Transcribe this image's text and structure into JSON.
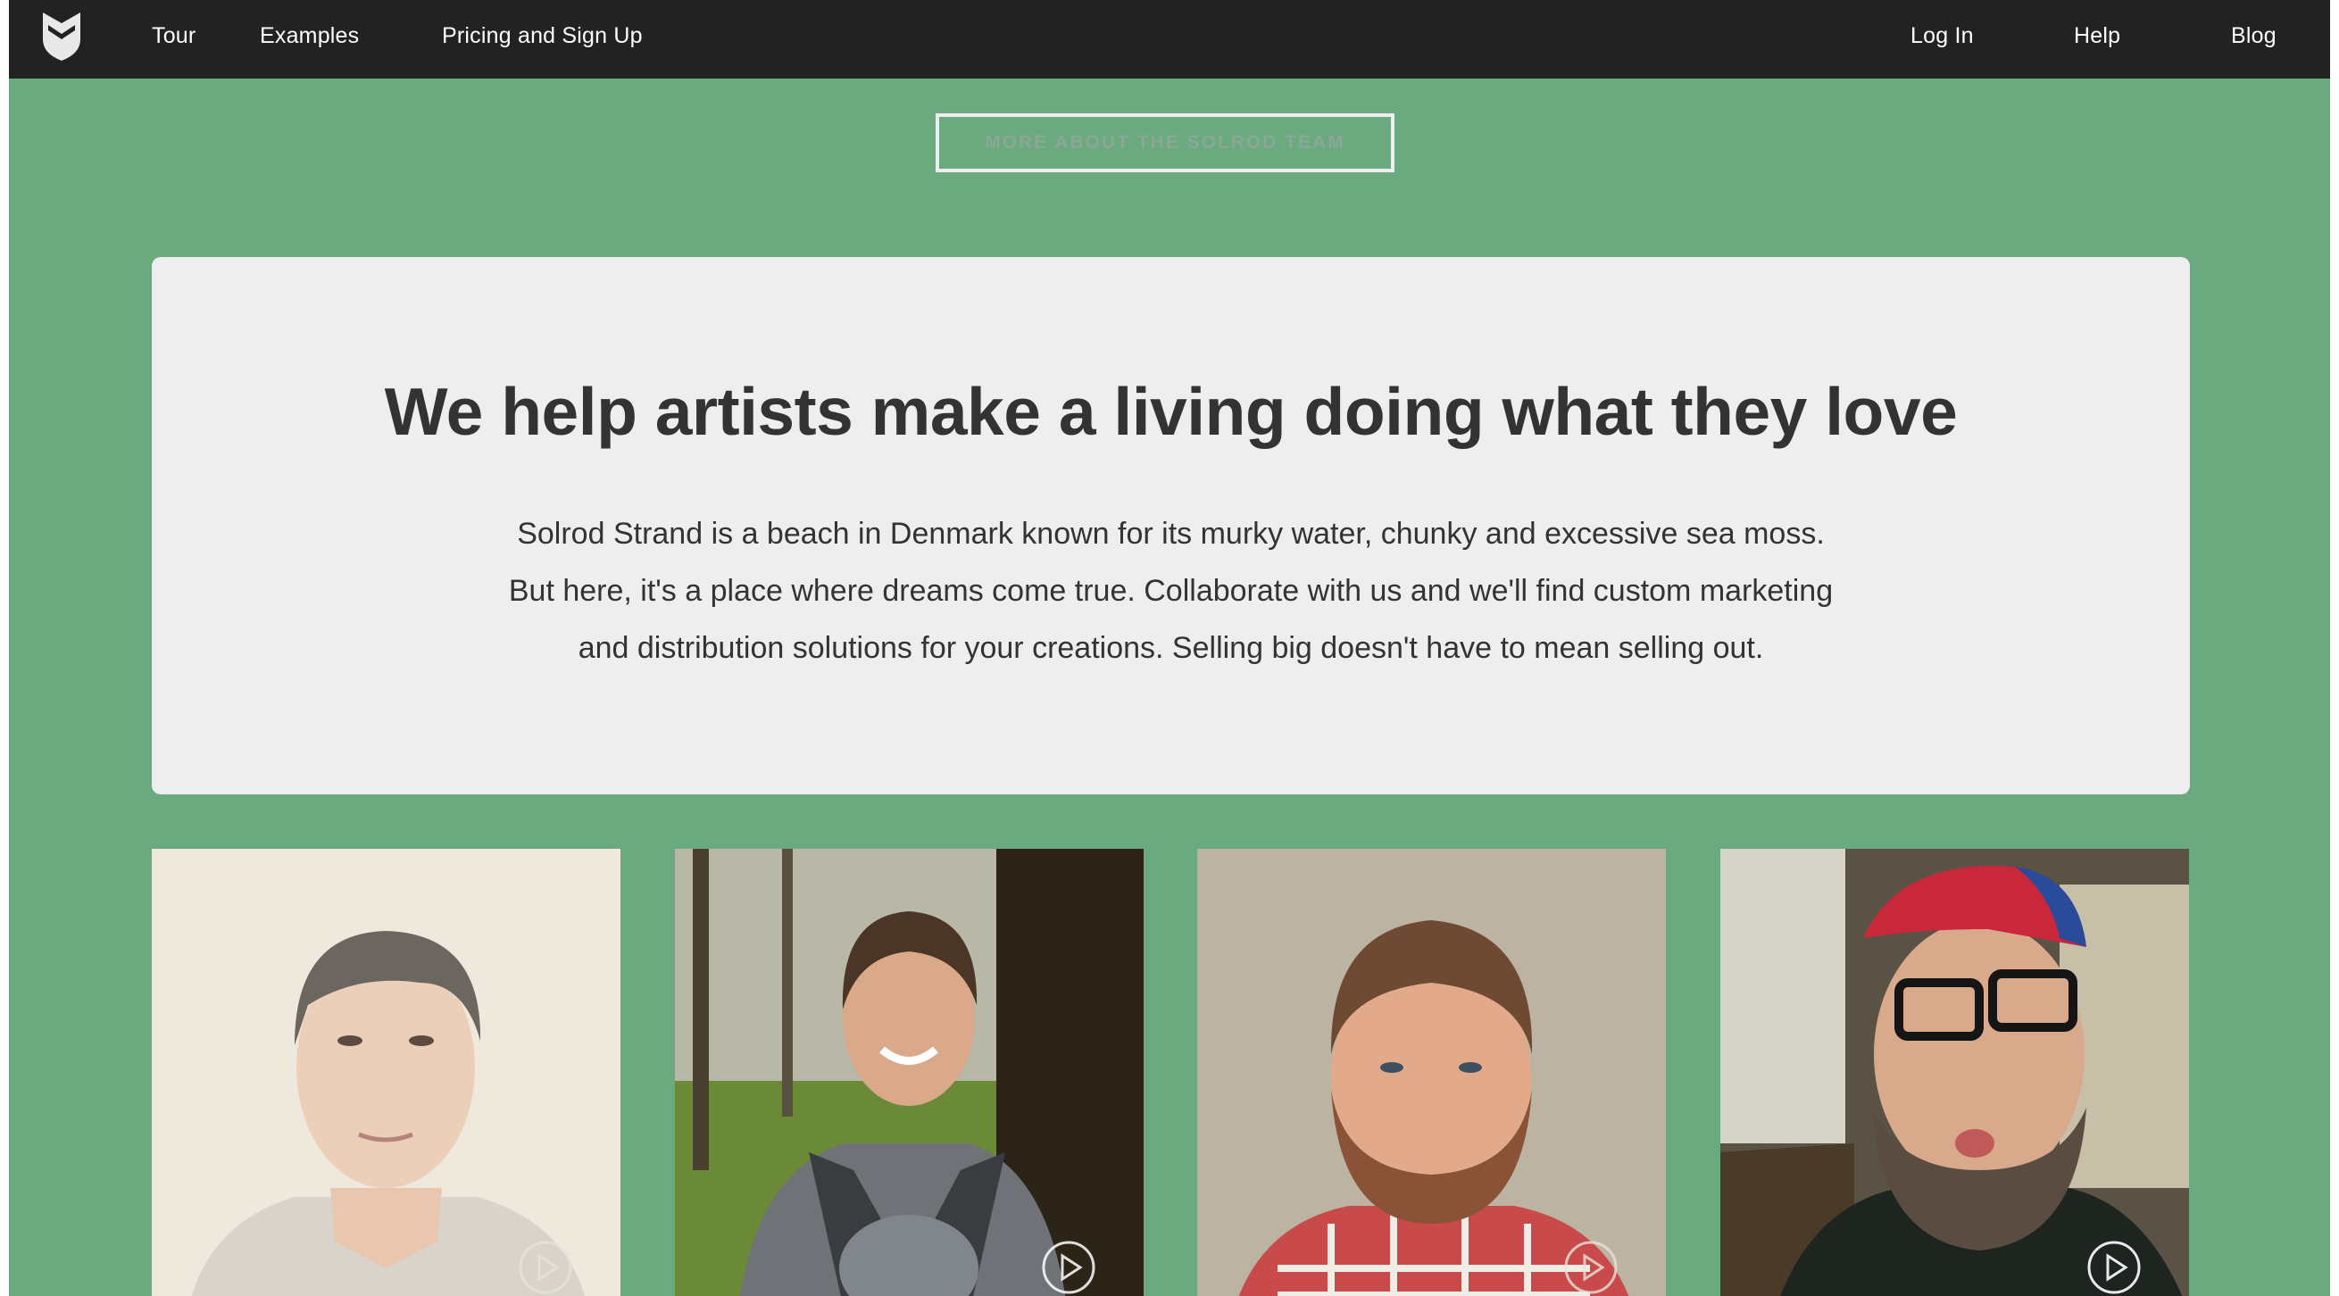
{
  "nav": {
    "logo_icon": "shield-leaf-logo-icon",
    "left_links": [
      "Tour",
      "Examples",
      "Pricing and Sign Up"
    ],
    "right_links": [
      "Log In",
      "Help",
      "Blog"
    ]
  },
  "more_button": {
    "label": "MORE ABOUT THE SOLROD TEAM"
  },
  "hero": {
    "title": "We help artists make a living doing what they love",
    "paragraph_lines": [
      "Solrod Strand is a beach in Denmark known for its murky water, chunky and excessive sea moss.",
      "But here, it's a place where dreams come true. Collaborate with us and we'll find custom marketing",
      "and distribution solutions for your creations. Selling big doesn't have to mean selling out."
    ]
  },
  "team": {
    "play_icon": "play-icon",
    "members": [
      {
        "photo": "man-gray-hair-portrait"
      },
      {
        "photo": "woman-outdoors-with-baby-portrait"
      },
      {
        "photo": "man-red-beard-portrait"
      },
      {
        "photo": "man-cap-glasses-beard-portrait"
      }
    ]
  },
  "colors": {
    "navbar": "#222222",
    "page_background": "#6aaa7e",
    "card_background": "#eeeeee",
    "text": "#333333",
    "button_text": "#8aa895"
  }
}
